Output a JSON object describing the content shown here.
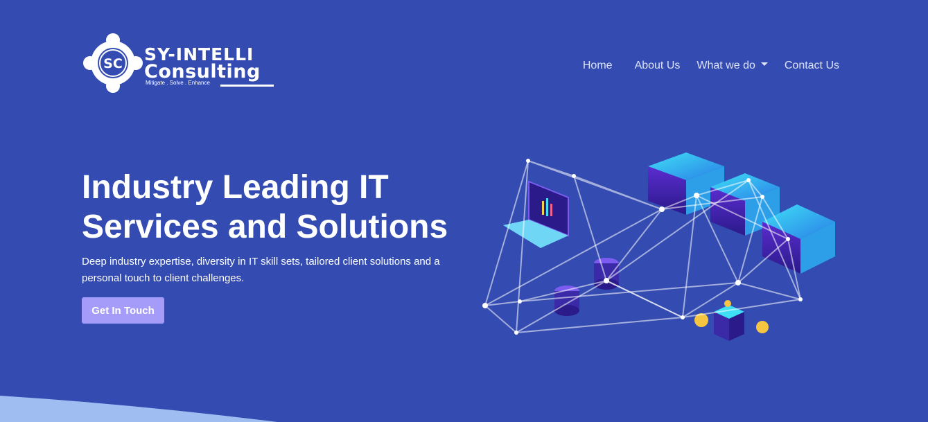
{
  "brand": {
    "line1": "SY-INTELLI",
    "line2": "Consulting",
    "tagline": "Mitigate . Solve . Enhance",
    "monogram": "SC"
  },
  "nav": {
    "items": [
      {
        "label": "Home"
      },
      {
        "label": "About Us"
      },
      {
        "label": "What we do"
      },
      {
        "label": "Contact Us"
      }
    ]
  },
  "hero": {
    "title": "Industry Leading IT Services and Solutions",
    "subtitle": "Deep industry expertise, diversity in IT skill sets, tailored client solutions and a personal touch to client challenges.",
    "cta_label": "Get In Touch"
  },
  "colors": {
    "background": "#344cb1",
    "cta": "#a49cf8",
    "nav_text": "#dde2f7",
    "wave": "#9fbdf0"
  },
  "icons": [
    "logo-emblem-icon",
    "dropdown-caret-icon",
    "network-illustration"
  ]
}
